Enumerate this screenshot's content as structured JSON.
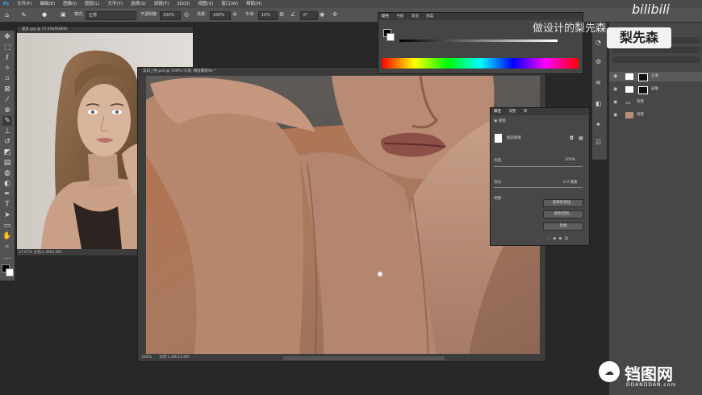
{
  "menubar": {
    "items": [
      "文件(F)",
      "编辑(E)",
      "图像(I)",
      "图层(L)",
      "文字(Y)",
      "选择(S)",
      "滤镜(T)",
      "3D(D)",
      "视图(V)",
      "窗口(W)",
      "帮助(H)"
    ]
  },
  "optbar": {
    "mode_label": "模式:",
    "mode_value": "正常",
    "opacity_label": "不透明度:",
    "opacity_value": "100%",
    "flow_label": "流量:",
    "flow_value": "100%",
    "smooth_label": "平滑:",
    "smooth_value": "10%",
    "angle_value": "0°"
  },
  "doc_small": {
    "tab": "美女.jpg @ 37.5%(RGB/8)",
    "status": "37.67% 文档:1.4M/2.6M"
  },
  "doc_main": {
    "tab": "美白上色.psd @ 100% (头发, 图层蒙版/8) *",
    "status_zoom": "100%",
    "status_doc": "文档:1.4M/13.9M"
  },
  "color_panel": {
    "tabs": [
      "颜色",
      "色板",
      "渐变",
      "图案"
    ]
  },
  "props_panel": {
    "tabs": [
      "属性",
      "调整",
      "库"
    ],
    "mask_label": "蒙版",
    "layer_mask_label": "图层蒙版",
    "density_label": "浓度:",
    "density_value": "100%",
    "feather_label": "羽化:",
    "feather_value": "0.0 像素",
    "refine_label": "调整:",
    "btn_select_mask": "选择并遮住...",
    "btn_color_range": "颜色范围...",
    "btn_invert": "反相"
  },
  "layers_panel": {
    "layers": [
      {
        "name": "头发",
        "type": "mask"
      },
      {
        "name": "皮肤",
        "type": "mask"
      },
      {
        "name": "背景",
        "type": "folder"
      },
      {
        "name": "背景",
        "type": "image"
      }
    ]
  },
  "watermark": {
    "top_text": "做设计的梨先森",
    "badge": "梨先森",
    "bilibili": "bilibili",
    "logo_cn": "铛图网",
    "logo_en": "DDANDDAN.com"
  }
}
